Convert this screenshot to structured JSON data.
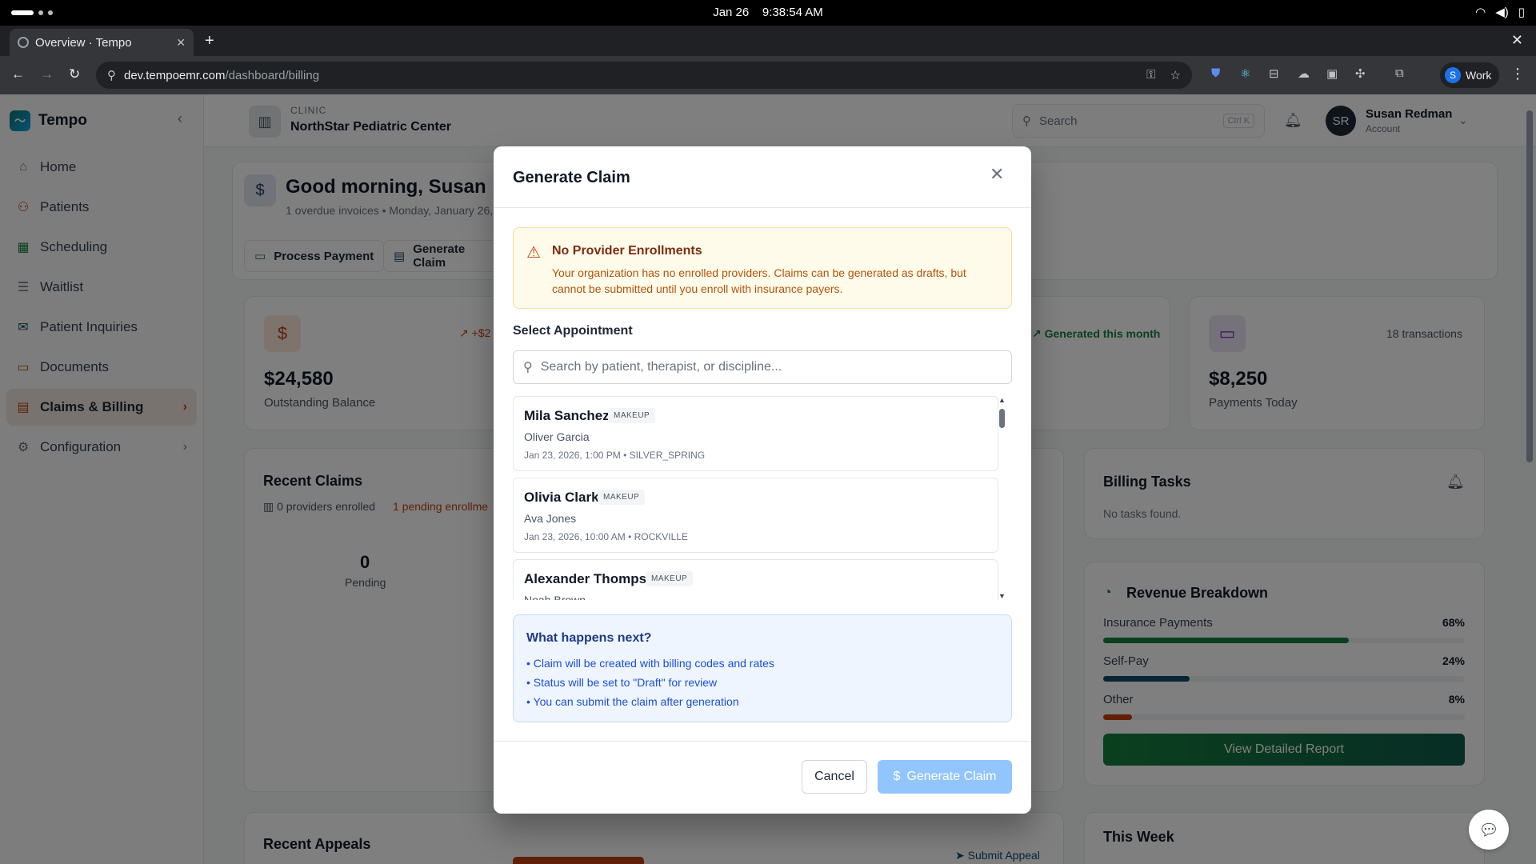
{
  "os": {
    "date": "Jan 26",
    "time": "9:38:54 AM"
  },
  "browser": {
    "tab_title": "Overview · Tempo",
    "url_host": "dev.tempoemr.com",
    "url_path": "/dashboard/billing",
    "profile_initial": "S",
    "profile_label": "Work"
  },
  "sidebar": {
    "brand": "Tempo",
    "items": [
      {
        "label": "Home",
        "icon": "home-icon",
        "glyph": "⌂"
      },
      {
        "label": "Patients",
        "icon": "users-icon",
        "glyph": "👥"
      },
      {
        "label": "Scheduling",
        "icon": "calendar-icon",
        "glyph": "▦"
      },
      {
        "label": "Waitlist",
        "icon": "list-check-icon",
        "glyph": "☰"
      },
      {
        "label": "Patient Inquiries",
        "icon": "mail-icon",
        "glyph": "✉"
      },
      {
        "label": "Documents",
        "icon": "folder-icon",
        "glyph": "▭"
      },
      {
        "label": "Claims & Billing",
        "icon": "receipt-icon",
        "glyph": "▤"
      },
      {
        "label": "Configuration",
        "icon": "gear-icon",
        "glyph": "⚙"
      }
    ]
  },
  "header": {
    "clinic_label": "CLINIC",
    "clinic_name": "NorthStar Pediatric Center",
    "search_placeholder": "Search",
    "search_shortcut": "Ctrl K",
    "user_initials": "SR",
    "user_name": "Susan Redman",
    "user_role": "Account"
  },
  "dashboard": {
    "greeting": "Good morning, Susan",
    "subline": "1 overdue invoices • Monday, January 26,",
    "actions": {
      "process_payment": "Process Payment",
      "generate_claim": "Generate Claim"
    },
    "stats": {
      "outstanding_value": "$24,580",
      "outstanding_label": "Outstanding Balance",
      "outstanding_trend": "+$2",
      "generated_label": "Generated this month",
      "payments_value": "$8,250",
      "payments_label": "Payments Today",
      "payments_meta": "18 transactions"
    },
    "recent_claims": {
      "title": "Recent Claims",
      "providers": "0 providers enrolled",
      "pending_enroll": "1 pending enrollme",
      "pending_count": "0",
      "pending_label": "Pending"
    },
    "billing_tasks": {
      "title": "Billing Tasks",
      "empty": "No tasks found."
    },
    "revenue": {
      "title": "Revenue Breakdown",
      "rows": [
        {
          "label": "Insurance Payments",
          "pct": "68%",
          "value": 0.68,
          "color": "#15803d"
        },
        {
          "label": "Self-Pay",
          "pct": "24%",
          "value": 0.24,
          "color": "#0f4c6b"
        },
        {
          "label": "Other",
          "pct": "8%",
          "value": 0.08,
          "color": "#c2410c"
        }
      ],
      "report_button": "View Detailed Report"
    },
    "recent_appeals": {
      "title": "Recent Appeals",
      "submit": "Submit Appeal"
    },
    "this_week": {
      "title": "This Week"
    }
  },
  "modal": {
    "title": "Generate Claim",
    "warning_title": "No Provider Enrollments",
    "warning_body": "Your organization has no enrolled providers. Claims can be generated as drafts, but cannot be submitted until you enroll with insurance payers.",
    "select_label": "Select Appointment",
    "search_placeholder": "Search by patient, therapist, or discipline...",
    "appointments": [
      {
        "patient": "Mila Sanchez",
        "badge": "MAKEUP",
        "therapist": "Oliver Garcia",
        "meta": "Jan 23, 2026, 1:00 PM • SILVER_SPRING"
      },
      {
        "patient": "Olivia Clark",
        "badge": "MAKEUP",
        "therapist": "Ava Jones",
        "meta": "Jan 23, 2026, 10:00 AM • ROCKVILLE"
      },
      {
        "patient": "Alexander Thompson",
        "badge": "MAKEUP",
        "therapist": "Noah Brown",
        "meta": ""
      }
    ],
    "next_title": "What happens next?",
    "next_items": [
      "• Claim will be created with billing codes and rates",
      "• Status will be set to \"Draft\" for review",
      "• You can submit the claim after generation"
    ],
    "cancel": "Cancel",
    "generate": "Generate Claim"
  }
}
